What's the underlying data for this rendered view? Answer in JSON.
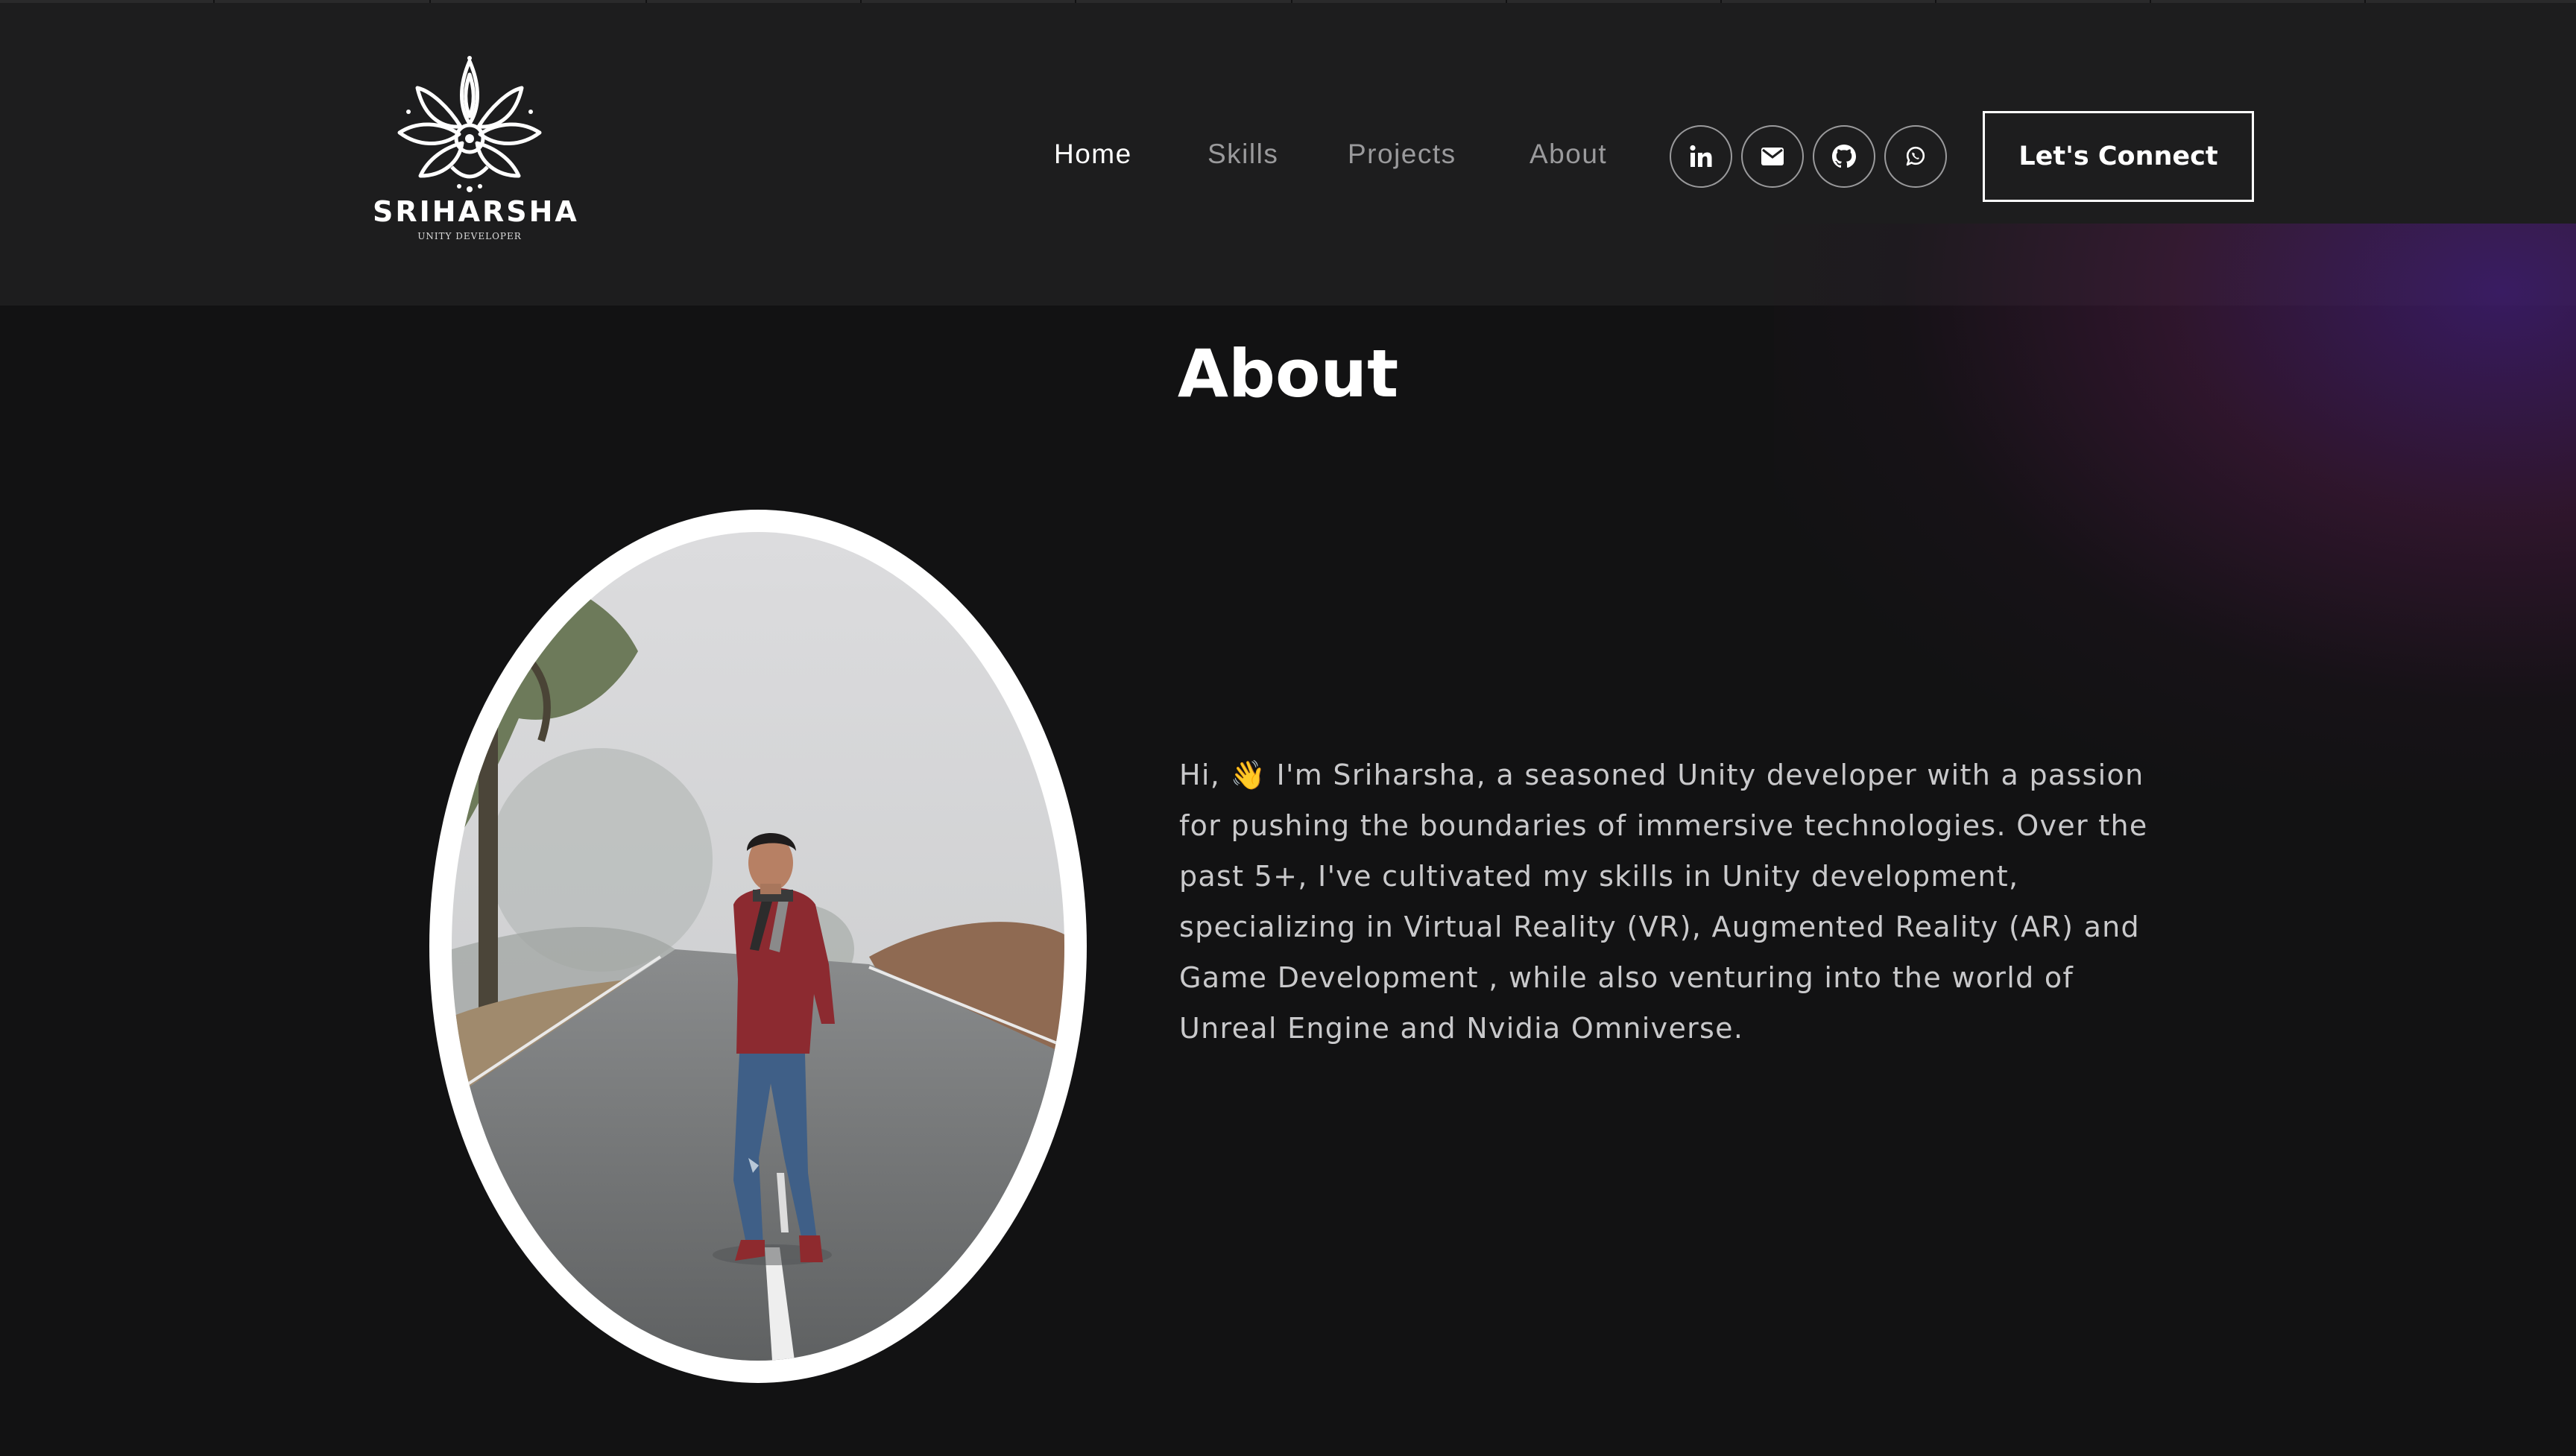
{
  "brand": {
    "name": "SRIHARSHA",
    "tagline": "UNITY DEVELOPER",
    "logo_icon": "mandala-flower-icon"
  },
  "nav": {
    "items": [
      {
        "label": "Home",
        "active": true
      },
      {
        "label": "Skills",
        "active": false
      },
      {
        "label": "Projects",
        "active": false
      },
      {
        "label": "About",
        "active": false
      }
    ]
  },
  "social": [
    {
      "icon": "linkedin-icon"
    },
    {
      "icon": "mail-icon"
    },
    {
      "icon": "github-icon"
    },
    {
      "icon": "whatsapp-icon"
    }
  ],
  "cta": {
    "label": "Let's Connect"
  },
  "about": {
    "title": "About",
    "bio": "Hi, 👋 I'm Sriharsha, a seasoned Unity developer with a passion for pushing the boundaries of immersive technologies. Over the past 5+, I've cultivated my skills in Unity development, specializing in Virtual Reality (VR), Augmented Reality (AR) and Game Development , while also venturing into the world of Unreal Engine and Nvidia Omniverse."
  },
  "colors": {
    "background": "#121213",
    "header": "#1d1d1e",
    "text_muted": "#9a9a9c",
    "accent_glow": "#3e1c6e"
  }
}
